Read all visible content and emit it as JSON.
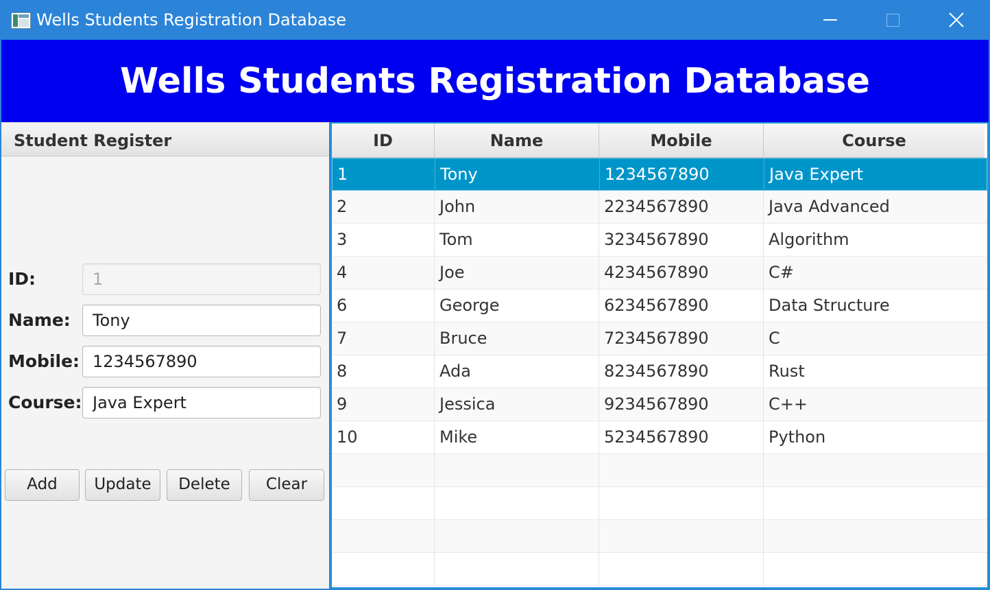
{
  "window": {
    "title": "Wells Students Registration Database"
  },
  "banner": {
    "title": "Wells Students Registration Database"
  },
  "form": {
    "header": "Student Register",
    "id_label": "ID:",
    "id_value": "1",
    "name_label": "Name:",
    "name_value": "Tony",
    "mobile_label": "Mobile:",
    "mobile_value": "1234567890",
    "course_label": "Course:",
    "course_value": "Java Expert",
    "buttons": {
      "add": "Add",
      "update": "Update",
      "delete": "Delete",
      "clear": "Clear"
    }
  },
  "table": {
    "columns": [
      "ID",
      "Name",
      "Mobile",
      "Course"
    ],
    "selected_row": 0,
    "rows": [
      {
        "id": "1",
        "name": "Tony",
        "mobile": "1234567890",
        "course": "Java Expert"
      },
      {
        "id": "2",
        "name": "John",
        "mobile": "2234567890",
        "course": "Java Advanced"
      },
      {
        "id": "3",
        "name": "Tom",
        "mobile": "3234567890",
        "course": "Algorithm"
      },
      {
        "id": "4",
        "name": "Joe",
        "mobile": "4234567890",
        "course": "C#"
      },
      {
        "id": "6",
        "name": "George",
        "mobile": "6234567890",
        "course": "Data Structure"
      },
      {
        "id": "7",
        "name": "Bruce",
        "mobile": "7234567890",
        "course": "C"
      },
      {
        "id": "8",
        "name": "Ada",
        "mobile": "8234567890",
        "course": "Rust"
      },
      {
        "id": "9",
        "name": "Jessica",
        "mobile": "9234567890",
        "course": "C++"
      },
      {
        "id": "10",
        "name": "Mike",
        "mobile": "5234567890",
        "course": "Python"
      }
    ],
    "empty_rows": 4
  },
  "colors": {
    "titlebar": "#2b84d8",
    "banner": "#0000f0",
    "selection": "#0095c9",
    "table_border": "#1f93d6"
  }
}
